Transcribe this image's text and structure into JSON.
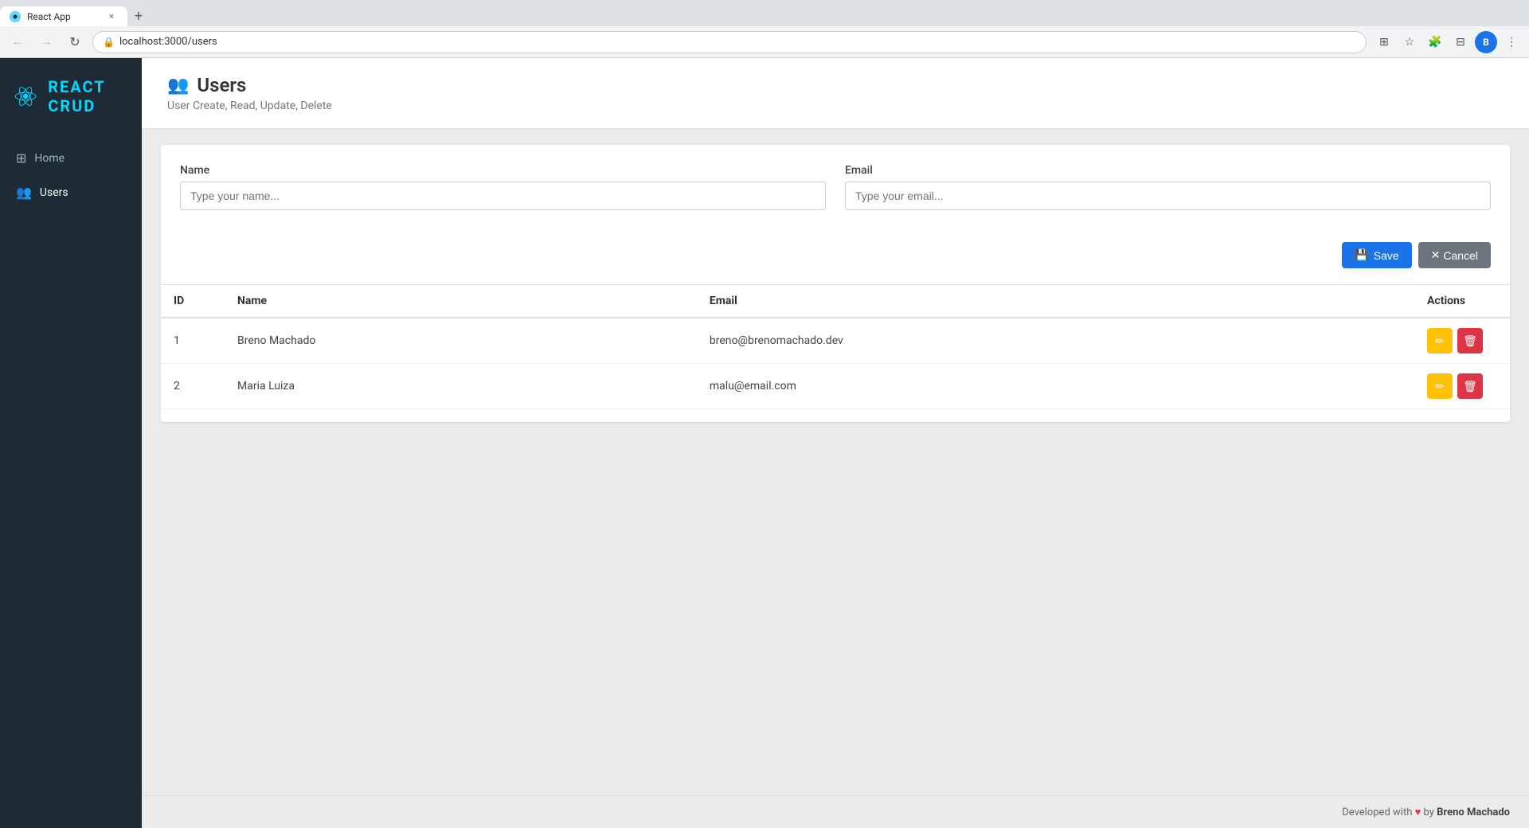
{
  "browser": {
    "tab_title": "React App",
    "tab_close": "×",
    "tab_new": "+",
    "url": "localhost:3000/users",
    "nav": {
      "back": "←",
      "forward": "→",
      "reload": "↻"
    }
  },
  "sidebar": {
    "brand": "REACT CRUD",
    "nav_items": [
      {
        "id": "home",
        "label": "Home",
        "icon": "⊞"
      },
      {
        "id": "users",
        "label": "Users",
        "icon": "👥"
      }
    ]
  },
  "page": {
    "title": "Users",
    "subtitle": "User Create, Read, Update, Delete",
    "title_icon": "👥"
  },
  "form": {
    "name_label": "Name",
    "name_placeholder": "Type your name...",
    "email_label": "Email",
    "email_placeholder": "Type your email...",
    "save_label": "Save",
    "cancel_label": "Cancel"
  },
  "table": {
    "columns": {
      "id": "ID",
      "name": "Name",
      "email": "Email",
      "actions": "Actions"
    },
    "rows": [
      {
        "id": 1,
        "name": "Breno Machado",
        "email": "breno@brenomachado.dev"
      },
      {
        "id": 2,
        "name": "Maria Luiza",
        "email": "malu@email.com"
      }
    ]
  },
  "footer": {
    "prefix": "Developed with",
    "heart": "♥",
    "by": "by",
    "author": "Breno Machado"
  },
  "colors": {
    "sidebar_bg": "#1c2b35",
    "accent": "#00d8ff",
    "save_btn": "#1a73e8",
    "edit_btn": "#ffc107",
    "delete_btn": "#dc3545"
  }
}
